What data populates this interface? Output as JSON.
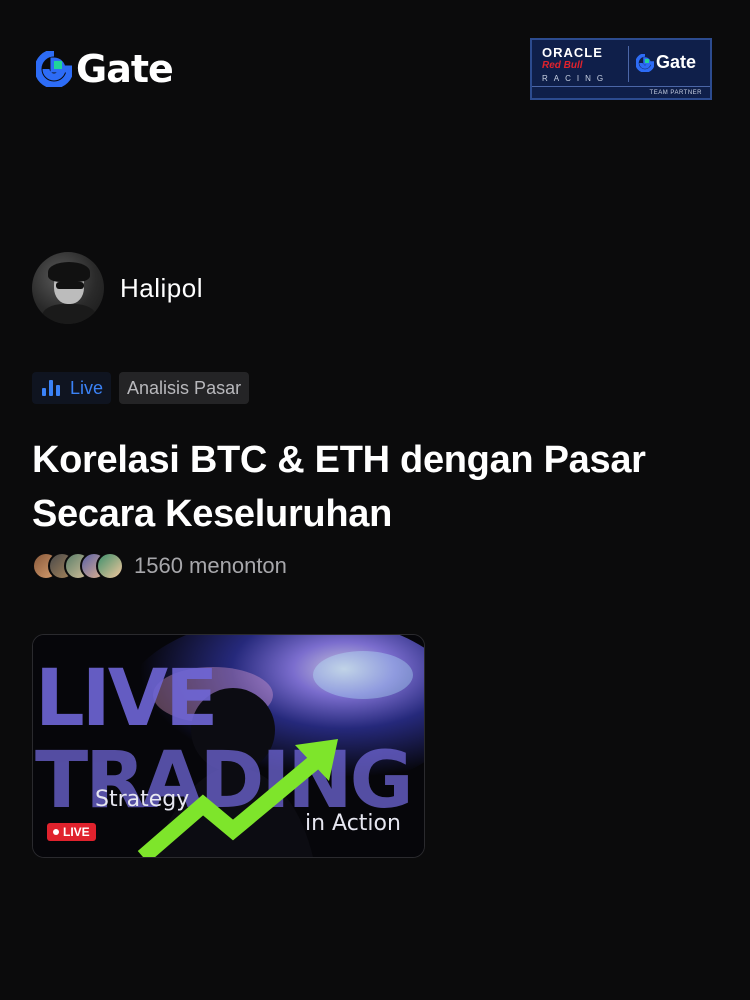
{
  "header": {
    "logo_text": "Gate",
    "partner": {
      "line1": "ORACLE",
      "line2": "Red Bull",
      "line3": "RACING",
      "brand": "Gate",
      "footer": "TEAM PARTNER"
    }
  },
  "author": {
    "name": "Halipol"
  },
  "tags": {
    "live_label": "Live",
    "category": "Analisis Pasar"
  },
  "stream": {
    "title": "Korelasi BTC & ETH dengan Pasar Secara Keseluruhan",
    "viewers": "1560 menonton"
  },
  "thumbnail": {
    "big_line1": "LIVE",
    "big_line2": "TRADING",
    "caption_left": "Strategy",
    "caption_right": "in Action",
    "live_badge": "LIVE"
  },
  "colors": {
    "background": "#0b0b0c",
    "accent_blue": "#3b82f6",
    "live_red": "#e0222d",
    "arrow_green": "#7ee52b"
  },
  "icons": [
    "gate-logo-icon",
    "live-bars-icon",
    "avatar-icon",
    "trend-arrow-icon"
  ]
}
